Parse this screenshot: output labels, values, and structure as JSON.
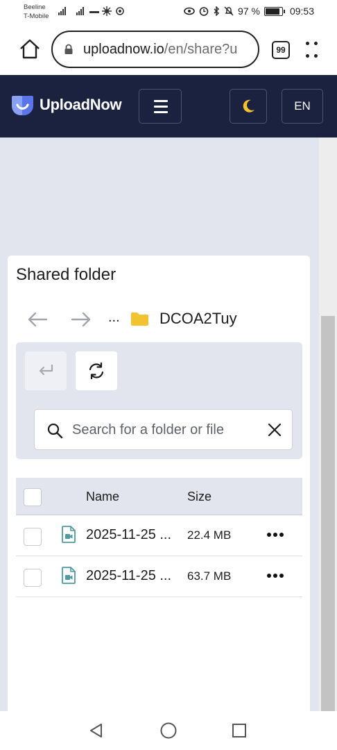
{
  "status_bar": {
    "carrier_1": "Beeline",
    "carrier_2": "T-Mobile",
    "battery": "97 %",
    "time": "09:53"
  },
  "browser": {
    "url_host": "uploadnow.io",
    "url_path": "/en/share?u",
    "tab_count": "99"
  },
  "app": {
    "brand": "UploadNow",
    "language": "EN",
    "brand_color": "#1b2240",
    "accent_color": "#f2c230"
  },
  "panel": {
    "title": "Shared folder",
    "breadcrumb_ellipsis": "...",
    "folder_name": "DCOA2Tuy",
    "search_placeholder": "Search for a folder or file"
  },
  "table": {
    "columns": [
      "Name",
      "Size"
    ],
    "rows": [
      {
        "name": "2025-11-25 ...",
        "size": "22.4 MB",
        "icon": "video-file-icon"
      },
      {
        "name": "2025-11-25 ...",
        "size": "63.7 MB",
        "icon": "video-file-icon"
      }
    ]
  }
}
